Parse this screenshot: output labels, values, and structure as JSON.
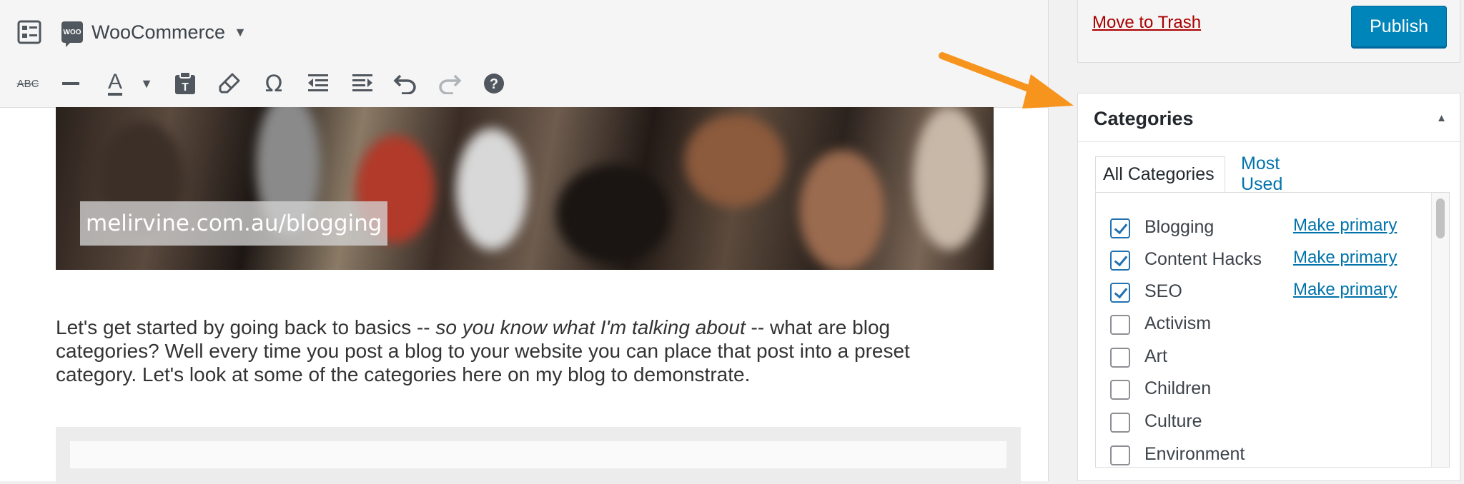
{
  "toolbar": {
    "woocommerce_label": "WooCommerce",
    "woo_logo_text": "WOO",
    "row1_icons": [
      "toolbar-toggle-icon"
    ],
    "row2_icons": [
      "strikethrough-icon",
      "horizontal-line-icon",
      "text-color-icon",
      "chevron-down-icon",
      "paste-as-text-icon",
      "clear-formatting-icon",
      "special-character-icon",
      "outdent-icon",
      "indent-icon",
      "undo-icon",
      "redo-icon",
      "help-icon"
    ],
    "strikethrough_text": "ABC",
    "text_color_letter": "A",
    "omega_symbol": "Ω",
    "help_symbol": "?"
  },
  "content": {
    "banner_caption": "melirvine.com.au/blogging",
    "paragraph_part1": "Let's get started by going back to basics -- ",
    "paragraph_italic": "so you know what I'm talking about",
    "paragraph_part2": " -- what are blog categories? Well every time you post a blog to your website you can place that post into a preset category. Let's look at some of the categories here on my blog to demonstrate."
  },
  "publish_box": {
    "trash_label": "Move to Trash",
    "publish_label": "Publish"
  },
  "categories": {
    "title": "Categories",
    "toggle_symbol": "▲",
    "tabs": [
      "All Categories",
      "Most Used"
    ],
    "items": [
      {
        "name": "Blogging",
        "checked": true,
        "action": "Make primary"
      },
      {
        "name": "Content Hacks",
        "checked": true,
        "action": "Make primary"
      },
      {
        "name": "SEO",
        "checked": true,
        "action": "Make primary"
      },
      {
        "name": "Activism",
        "checked": false,
        "action": ""
      },
      {
        "name": "Art",
        "checked": false,
        "action": ""
      },
      {
        "name": "Children",
        "checked": false,
        "action": ""
      },
      {
        "name": "Culture",
        "checked": false,
        "action": ""
      },
      {
        "name": "Environment",
        "checked": false,
        "action": ""
      }
    ]
  },
  "colors": {
    "link": "#0073aa",
    "trash": "#aa0000",
    "publish": "#0085ba",
    "annotation_arrow": "#f7941d",
    "checkbox": "#2271b1"
  }
}
